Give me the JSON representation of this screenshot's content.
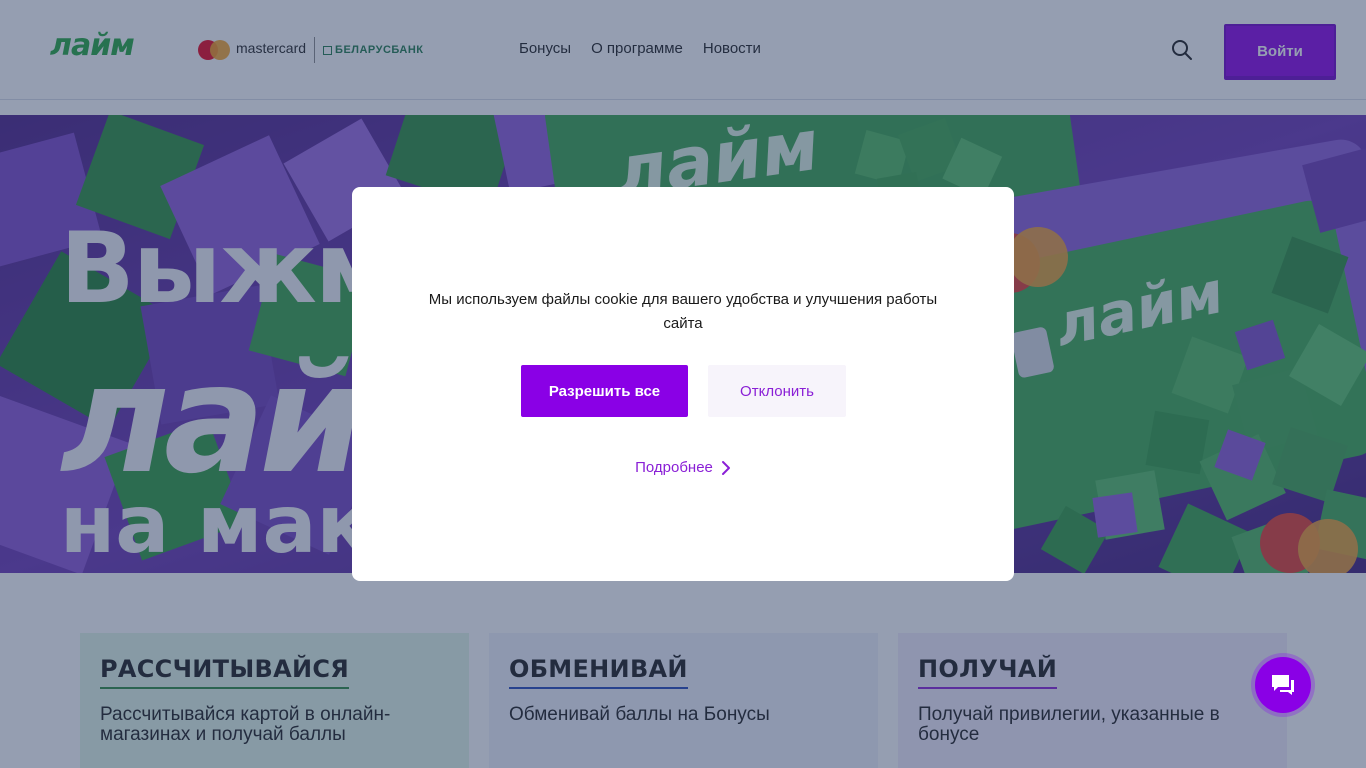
{
  "colors": {
    "brand_green": "#23a63c",
    "brand_purple": "#8a00e6",
    "link_purple": "#8a1fd6",
    "mc_red": "#eb001b",
    "mc_orange": "#f79e1b",
    "bank_green": "#1f7a4a",
    "card1_bg": "#e3f7e6",
    "card1_rule": "#2a8a3e",
    "card2_bg": "#f1f2fb",
    "card2_rule": "#2346b8",
    "card3_bg": "#f3ecfb",
    "card3_rule": "#8a1fd6"
  },
  "header": {
    "logo_text": "лайм",
    "mastercard_label": "mastercard",
    "bank_label": "БЕЛАРУСБАНК",
    "nav": [
      "Бонусы",
      "О программе",
      "Новости"
    ],
    "search_icon": "search-icon",
    "login_label": "Войти"
  },
  "hero": {
    "line1": "Выжми",
    "line2": "лайм",
    "line3": "на макс"
  },
  "cards": [
    {
      "title": "РАССЧИТЫВАЙСЯ",
      "text": "Рассчитывайся картой в онлайн-магазинах и получай баллы"
    },
    {
      "title": "ОБМЕНИВАЙ",
      "text": "Обменивай баллы на Бонусы"
    },
    {
      "title": "ПОЛУЧАЙ",
      "text": "Получай привилегии, указанные в бонусе"
    }
  ],
  "cookie_modal": {
    "message": "Мы используем файлы cookie для вашего удобства и улучшения работы сайта",
    "allow_label": "Разрешить все",
    "decline_label": "Отклонить",
    "more_label": "Подробнее"
  },
  "chat": {
    "icon": "chat-icon"
  }
}
